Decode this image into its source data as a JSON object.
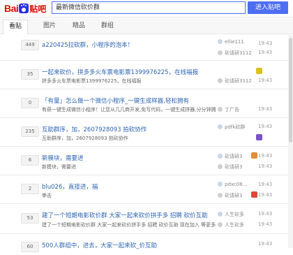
{
  "header": {
    "logo_text_left": "Bai",
    "logo_text_right": "贴吧",
    "search_value": "最新微信砍价群",
    "enter_button": "进入贴吧"
  },
  "tabs": [
    {
      "label": "看贴"
    },
    {
      "label": "图片"
    },
    {
      "label": "精品"
    },
    {
      "label": "群组"
    }
  ],
  "threads": [
    {
      "replies": "449",
      "title": "a220425拉砍群，小程序的泡本！",
      "snippet": "",
      "author": "ellie111",
      "last_reply": "砍请研3112",
      "time_top": "19:43",
      "time_bottom": "19:43"
    },
    {
      "replies": "35",
      "title": "一起来砍价，拼多多火车票电影票1399976225，在线福报",
      "snippet": "拼多多火车票电影票1399976225，在线福报",
      "author": "",
      "last_reply": "砍请研3112",
      "time_top": "19:43",
      "time_bottom": "19:43"
    },
    {
      "replies": "0",
      "title": "「有量」怎么做一个微信小程序_一键生成样器,轻松拥有",
      "snippet": "有获一键生成微信小程序！让您从几几商开发,免写代码，一键生成拼器,分分钟拥有小程序",
      "author": "",
      "last_reply": "丁广告",
      "time_top": "",
      "time_bottom": "19:43"
    },
    {
      "replies": "235",
      "title": "互助群序，加，2607928093 拍砍协作",
      "snippet": "互助群序，加，2607928093 拍砍协作",
      "author": "pdfk砍群",
      "last_reply": "",
      "time_top": "19:43",
      "time_bottom": "19:43"
    },
    {
      "replies": "6",
      "title": "新模块，需要进",
      "snippet": "新模块，需要进",
      "author": "砍请研3",
      "last_reply": "砍请研3",
      "time_top": "19:43",
      "time_bottom": "19:43"
    },
    {
      "replies": "2",
      "title": "blu026，直接进，福",
      "snippet": "拳击",
      "author": "pdxc08...",
      "last_reply": "砍请研3",
      "time_top": "19:43",
      "time_bottom": "19:43"
    },
    {
      "replies": "53",
      "title": "建了一个短期电影砍价群 大家一起来砍价拼手多 招聘 砍价互助",
      "snippet": "建了一个短期电影砍价群 大家一起来砍价拼手多 招聘 砍价互助 现在加入 等更多进群",
      "author": "人生砍多",
      "last_reply": "人生砍多",
      "time_top": "19:43",
      "time_bottom": "19:43"
    },
    {
      "replies": "60",
      "title": "500人群组中，进去，大家一起来砍_价互助",
      "snippet": "",
      "author": "",
      "last_reply": "",
      "time_top": "19:43",
      "time_bottom": ""
    }
  ]
}
